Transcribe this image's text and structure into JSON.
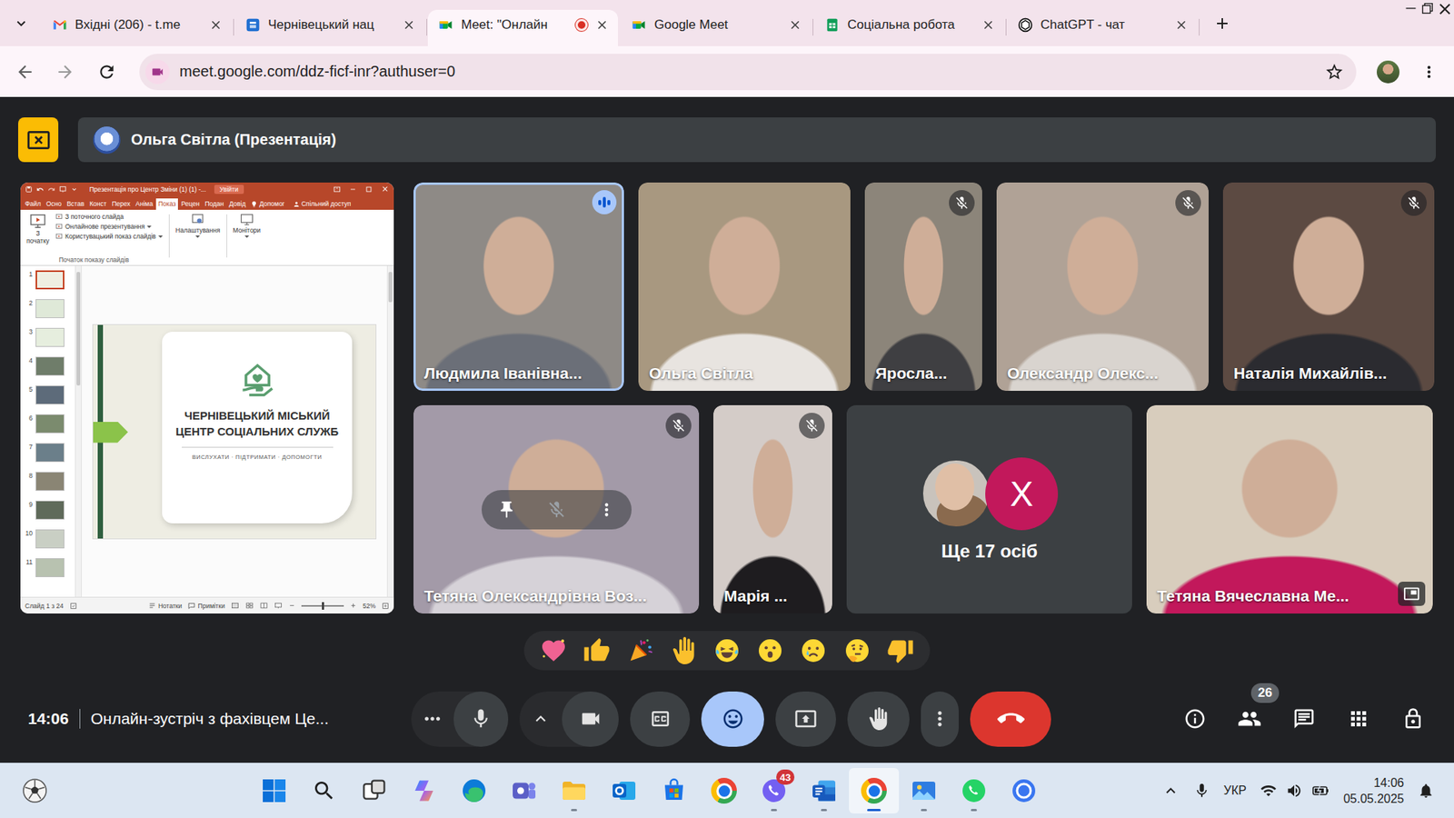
{
  "browser": {
    "tabs": [
      {
        "label": "Вхідні (206) - t.me",
        "kind": "gmail",
        "selected": false,
        "recording": false
      },
      {
        "label": "Чернівецький нац",
        "kind": "moodle",
        "selected": false,
        "recording": false
      },
      {
        "label": "Meet: \"Онлайн",
        "kind": "meet",
        "selected": true,
        "recording": true
      },
      {
        "label": "Google Meet",
        "kind": "meet",
        "selected": false,
        "recording": false
      },
      {
        "label": "Соціальна робота",
        "kind": "sheets",
        "selected": false,
        "recording": false
      },
      {
        "label": "ChatGPT - чат",
        "kind": "chatgpt",
        "selected": false,
        "recording": false
      }
    ],
    "address": "meet.google.com/ddz-ficf-inr?authuser=0",
    "bookmarked": false
  },
  "meet": {
    "banner": "Ольга Світла (Презентація)",
    "presentation": {
      "title": "Презентація про Центр Зміни (1) (1) -...",
      "sign_in": "Увійти",
      "ribbon_tabs": [
        {
          "label": "Файл",
          "selected": false
        },
        {
          "label": "Осно",
          "selected": false
        },
        {
          "label": "Встав",
          "selected": false
        },
        {
          "label": "Конст",
          "selected": false
        },
        {
          "label": "Перех",
          "selected": false
        },
        {
          "label": "Аніма",
          "selected": false
        },
        {
          "label": "Показ",
          "selected": true
        },
        {
          "label": "Рецен",
          "selected": false
        },
        {
          "label": "Подан",
          "selected": false
        },
        {
          "label": "Довід",
          "selected": false
        }
      ],
      "help": "Допомог",
      "share": "Спільний доступ",
      "from_start": "З початку",
      "start_items": [
        "З поточного слайда",
        "Онлайнове презентування",
        "Користувацький показ слайдів"
      ],
      "settings": "Налаштування",
      "monitors": "Монітори",
      "group_label": "Початок показу слайдів",
      "slides": [
        {
          "number": "1",
          "selected": true
        },
        {
          "number": "2",
          "selected": false
        },
        {
          "number": "3",
          "selected": false
        },
        {
          "number": "4",
          "selected": false
        },
        {
          "number": "5",
          "selected": false
        },
        {
          "number": "6",
          "selected": false
        },
        {
          "number": "7",
          "selected": false
        },
        {
          "number": "8",
          "selected": false
        },
        {
          "number": "9",
          "selected": false
        },
        {
          "number": "10",
          "selected": false
        },
        {
          "number": "11",
          "selected": false
        }
      ],
      "slide_title": [
        "ЧЕРНІВЕЦЬКИЙ МІСЬКИЙ",
        "ЦЕНТР СОЦІАЛЬНИХ СЛУЖБ"
      ],
      "slide_tagline": "ВИСЛУХАТИ · ПІДТРИМАТИ · ДОПОМОГТИ",
      "status_slide": "Слайд 1 з 24",
      "notes": "Нотатки",
      "comments": "Примітки",
      "zoom": "52%",
      "zoom_level": 0.5
    },
    "participants": [
      {
        "kind": "person",
        "name": "Людмила Іванівна...",
        "muted": false,
        "speaking": true,
        "hovered": false,
        "pip": false
      },
      {
        "kind": "person",
        "name": "Ольга Світла",
        "muted": false,
        "speaking": false,
        "hovered": false,
        "pip": false
      },
      {
        "kind": "person",
        "name": "Яросла...",
        "muted": true,
        "speaking": false,
        "hovered": false,
        "pip": false
      },
      {
        "kind": "person",
        "name": "Олександр Олекс...",
        "muted": true,
        "speaking": false,
        "hovered": false,
        "pip": false
      },
      {
        "kind": "person",
        "name": "Наталія Михайлів...",
        "muted": true,
        "speaking": false,
        "hovered": false,
        "pip": false
      },
      {
        "kind": "person",
        "name": "Тетяна Олександрівна Воз...",
        "muted": true,
        "speaking": false,
        "hovered": true,
        "pip": false
      },
      {
        "kind": "person",
        "name": "Марія ...",
        "muted": true,
        "speaking": false,
        "hovered": false,
        "pip": false
      },
      {
        "kind": "others",
        "label": "Ще 17 осіб",
        "initial": "Х"
      },
      {
        "kind": "person",
        "name": "Тетяна Вячеславна Ме...",
        "muted": false,
        "speaking": false,
        "hovered": false,
        "pip": true
      }
    ],
    "time": "14:06",
    "meeting_title": "Онлайн-зустріч з фахівцем Це...",
    "controls": [
      {
        "kind": "more-options",
        "selected": false
      },
      {
        "kind": "microphone",
        "selected": false
      },
      {
        "kind": "audio-options",
        "selected": false
      },
      {
        "kind": "camera",
        "selected": false
      },
      {
        "kind": "captions",
        "selected": false
      },
      {
        "kind": "reactions",
        "selected": true
      },
      {
        "kind": "present",
        "selected": false
      },
      {
        "kind": "raise-hand",
        "selected": false
      },
      {
        "kind": "more",
        "selected": false
      },
      {
        "kind": "leave-call",
        "selected": false
      }
    ],
    "people_count": "26"
  },
  "taskbar": {
    "apps": [
      {
        "kind": "windows",
        "running": false,
        "active": false
      },
      {
        "kind": "search",
        "running": false,
        "active": false
      },
      {
        "kind": "task-view",
        "running": false,
        "active": false
      },
      {
        "kind": "copilot",
        "running": false,
        "active": false
      },
      {
        "kind": "edge",
        "running": false,
        "active": false
      },
      {
        "kind": "teams",
        "running": false,
        "active": false
      },
      {
        "kind": "explorer",
        "running": true,
        "active": false
      },
      {
        "kind": "outlook",
        "running": false,
        "active": false
      },
      {
        "kind": "store",
        "running": false,
        "active": false
      },
      {
        "kind": "chrome",
        "running": false,
        "active": false
      },
      {
        "kind": "viber",
        "running": true,
        "active": false
      },
      {
        "kind": "word",
        "running": true,
        "active": false
      },
      {
        "kind": "chrome",
        "running": true,
        "active": true
      },
      {
        "kind": "photos",
        "running": true,
        "active": false
      },
      {
        "kind": "whatsapp",
        "running": true,
        "active": false
      },
      {
        "kind": "signal",
        "running": false,
        "active": false
      }
    ],
    "viber_badge": "43",
    "language": "УКР",
    "time": "14:06",
    "date": "05.05.2025"
  }
}
